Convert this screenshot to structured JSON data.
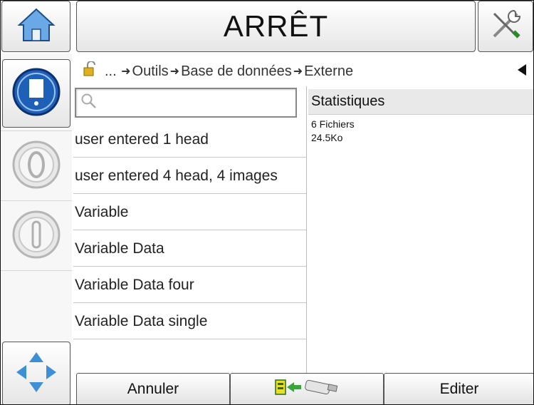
{
  "header": {
    "title": "ARRÊT"
  },
  "breadcrumb": {
    "ellipsis": "...",
    "items": [
      "Outils",
      "Base de données",
      "Externe"
    ]
  },
  "search": {
    "placeholder": ""
  },
  "files": {
    "items": [
      "user entered 1 head",
      "user entered 4 head, 4 images",
      "Variable",
      "Variable Data",
      "Variable Data four",
      "Variable Data single"
    ]
  },
  "stats": {
    "heading": "Statistiques",
    "files_count": "6 Fichiers",
    "size": "24.5Ko"
  },
  "footer": {
    "cancel_label": "Annuler",
    "edit_label": "Editer"
  },
  "colors": {
    "accent_blue": "#1e5fb8",
    "home_blue": "#3d8fd6",
    "arrow_green": "#3aa53a"
  }
}
